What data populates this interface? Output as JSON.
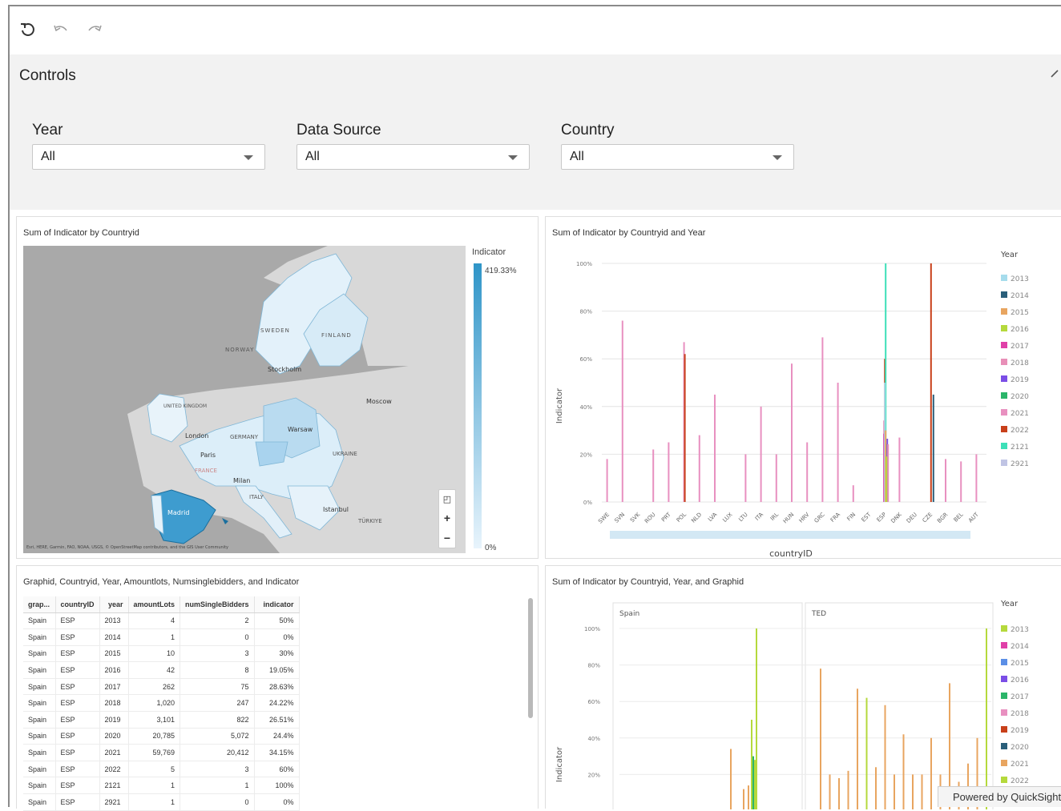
{
  "toolbar": {
    "icons": [
      "reset-icon",
      "undo-icon",
      "redo-icon"
    ]
  },
  "controls": {
    "title": "Controls",
    "year": {
      "label": "Year",
      "value": "All"
    },
    "data_source": {
      "label": "Data Source",
      "value": "All"
    },
    "country": {
      "label": "Country",
      "value": "All"
    }
  },
  "map_panel": {
    "title": "Sum of Indicator by Countryid",
    "legend_title": "Indicator",
    "legend_max": "419.33%",
    "legend_min": "0%",
    "attribution": "Esri, HERE, Garmin, FAO, NOAA, USGS, © OpenStreetMap contributors, and the GIS User Community",
    "labels": [
      "SWEDEN",
      "FINLAND",
      "NORWAY",
      "Stockholm",
      "Moscow",
      "UNITED KINGDOM",
      "London",
      "GERMANY",
      "Warsaw",
      "Paris",
      "FRANCE",
      "UKRAINE",
      "Milan",
      "ITALY",
      "Madrid",
      "Istanbul",
      "TÜRKIYE"
    ]
  },
  "bar_panel": {
    "title": "Sum of Indicator by Countryid and Year",
    "x_label": "countryID",
    "y_label": "Indicator",
    "legend_title": "Year"
  },
  "colors": {
    "2013": "#a6dcec",
    "2014": "#2a5f7a",
    "2015": "#e8a560",
    "2016": "#b5d93c",
    "2017": "#e040a8",
    "2018": "#e88fb8",
    "2019": "#7b4ee6",
    "2020": "#2bb56a",
    "2021": "#e890c0",
    "2022": "#c8401a",
    "2121": "#3de0b8",
    "2921": "#c0c4e4"
  },
  "chart_data": [
    {
      "type": "bar",
      "title": "Sum of Indicator by Countryid and Year",
      "xlabel": "countryID",
      "ylabel": "Indicator",
      "ylim": [
        0,
        100
      ],
      "yticks": [
        "0%",
        "20%",
        "40%",
        "60%",
        "80%",
        "100%"
      ],
      "categories": [
        "SWE",
        "SVN",
        "SVK",
        "ROU",
        "PRT",
        "POL",
        "NLD",
        "LVA",
        "LUX",
        "LTU",
        "ITA",
        "IRL",
        "HUN",
        "HRV",
        "GRC",
        "FRA",
        "FIN",
        "EST",
        "ESP",
        "DNK",
        "DEU",
        "CZE",
        "BGR",
        "BEL",
        "AUT"
      ],
      "legend": [
        "2013",
        "2014",
        "2015",
        "2016",
        "2017",
        "2018",
        "2019",
        "2020",
        "2021",
        "2022",
        "2121",
        "2921"
      ],
      "series": [
        {
          "name": "2021",
          "values": [
            18,
            76,
            0,
            22,
            25,
            67,
            28,
            45,
            0,
            20,
            40,
            20,
            58,
            25,
            69,
            50,
            7,
            0,
            34.15,
            27,
            0,
            0,
            18,
            17,
            20
          ]
        },
        {
          "name": "2022",
          "values": [
            0,
            0,
            0,
            0,
            0,
            62,
            0,
            0,
            0,
            0,
            0,
            0,
            0,
            0,
            0,
            0,
            0,
            0,
            60,
            0,
            0,
            100,
            0,
            0,
            0
          ]
        },
        {
          "name": "2121",
          "values": [
            0,
            0,
            0,
            0,
            0,
            0,
            0,
            0,
            0,
            0,
            0,
            0,
            0,
            0,
            0,
            0,
            0,
            0,
            100,
            0,
            0,
            0,
            0,
            0,
            0
          ]
        },
        {
          "name": "2020",
          "values": [
            0,
            0,
            0,
            0,
            0,
            0,
            0,
            0,
            0,
            0,
            0,
            0,
            0,
            0,
            0,
            0,
            0,
            0,
            24.4,
            0,
            0,
            0,
            0,
            0,
            0
          ]
        },
        {
          "name": "2019",
          "values": [
            0,
            0,
            0,
            0,
            0,
            0,
            0,
            0,
            0,
            0,
            0,
            0,
            0,
            0,
            0,
            0,
            0,
            0,
            26.51,
            0,
            0,
            0,
            0,
            0,
            0
          ]
        },
        {
          "name": "2018",
          "values": [
            0,
            0,
            0,
            0,
            0,
            0,
            0,
            0,
            0,
            0,
            0,
            0,
            0,
            0,
            0,
            0,
            0,
            0,
            24.22,
            0,
            0,
            0,
            0,
            0,
            0
          ]
        },
        {
          "name": "2017",
          "values": [
            0,
            0,
            0,
            0,
            0,
            0,
            0,
            0,
            0,
            0,
            0,
            0,
            0,
            0,
            0,
            0,
            0,
            0,
            28.63,
            0,
            0,
            0,
            0,
            0,
            0
          ]
        },
        {
          "name": "2013",
          "values": [
            0,
            0,
            0,
            0,
            0,
            0,
            0,
            0,
            0,
            0,
            0,
            0,
            0,
            0,
            0,
            0,
            0,
            0,
            50,
            0,
            0,
            0,
            0,
            0,
            0
          ]
        },
        {
          "name": "2015",
          "values": [
            0,
            0,
            0,
            0,
            0,
            0,
            0,
            0,
            0,
            0,
            0,
            0,
            0,
            0,
            0,
            0,
            0,
            0,
            30,
            0,
            0,
            0,
            0,
            0,
            0
          ]
        },
        {
          "name": "2016",
          "values": [
            0,
            0,
            0,
            0,
            0,
            0,
            0,
            0,
            0,
            0,
            0,
            0,
            0,
            0,
            0,
            0,
            0,
            0,
            19.05,
            0,
            0,
            0,
            0,
            0,
            0
          ]
        },
        {
          "name": "2014",
          "values": [
            0,
            0,
            0,
            0,
            0,
            0,
            0,
            0,
            0,
            0,
            0,
            0,
            0,
            0,
            0,
            0,
            0,
            0,
            0,
            0,
            0,
            45,
            0,
            0,
            0
          ]
        }
      ]
    },
    {
      "type": "bar",
      "title": "Sum of Indicator by Countryid, Year, and Graphid",
      "ylabel": "Indicator",
      "ylim": [
        0,
        100
      ],
      "yticks": [
        "20%",
        "40%",
        "60%",
        "80%",
        "100%"
      ],
      "facets": [
        "Spain",
        "TED"
      ],
      "legend": [
        "2013",
        "2014",
        "2015",
        "2016",
        "2017",
        "2018",
        "2019",
        "2020",
        "2021",
        "2022"
      ],
      "legend_colors": [
        "#b5d93c",
        "#e040a8",
        "#5b8fe6",
        "#7b4ee6",
        "#2bb56a",
        "#e890c0",
        "#c8401a",
        "#2a5f7a",
        "#e8a560",
        "#b5d93c"
      ],
      "spain_bars": [
        {
          "v": 34,
          "c": "#e8a560"
        },
        {
          "v": 12,
          "c": "#e8a560"
        },
        {
          "v": 14,
          "c": "#e8a560"
        },
        {
          "v": 50,
          "c": "#b5d93c"
        },
        {
          "v": 30,
          "c": "#2bb56a"
        },
        {
          "v": 28,
          "c": "#b5d93c"
        },
        {
          "v": 100,
          "c": "#b5d93c"
        }
      ],
      "ted_bars": [
        {
          "v": 78,
          "c": "#e8a560"
        },
        {
          "v": 20,
          "c": "#e8a560"
        },
        {
          "v": 18,
          "c": "#e8a560"
        },
        {
          "v": 22,
          "c": "#e8a560"
        },
        {
          "v": 67,
          "c": "#e8a560"
        },
        {
          "v": 62,
          "c": "#b5d93c"
        },
        {
          "v": 24,
          "c": "#e8a560"
        },
        {
          "v": 58,
          "c": "#e8a560"
        },
        {
          "v": 20,
          "c": "#e8a560"
        },
        {
          "v": 42,
          "c": "#e8a560"
        },
        {
          "v": 20,
          "c": "#e8a560"
        },
        {
          "v": 20,
          "c": "#e8a560"
        },
        {
          "v": 40,
          "c": "#e8a560"
        },
        {
          "v": 20,
          "c": "#e8a560"
        },
        {
          "v": 70,
          "c": "#e8a560"
        },
        {
          "v": 16,
          "c": "#e8a560"
        },
        {
          "v": 26,
          "c": "#e8a560"
        },
        {
          "v": 40,
          "c": "#e8a560"
        },
        {
          "v": 100,
          "c": "#b5d93c"
        }
      ]
    }
  ],
  "table_panel": {
    "title": "Graphid, Countryid, Year, Amountlots, Numsinglebidders, and Indicator",
    "columns": [
      "grap...",
      "countryID",
      "year",
      "amountLots",
      "numSingleBidders",
      "indicator"
    ],
    "rows": [
      [
        "Spain",
        "ESP",
        "2013",
        "4",
        "2",
        "50%"
      ],
      [
        "Spain",
        "ESP",
        "2014",
        "1",
        "0",
        "0%"
      ],
      [
        "Spain",
        "ESP",
        "2015",
        "10",
        "3",
        "30%"
      ],
      [
        "Spain",
        "ESP",
        "2016",
        "42",
        "8",
        "19.05%"
      ],
      [
        "Spain",
        "ESP",
        "2017",
        "262",
        "75",
        "28.63%"
      ],
      [
        "Spain",
        "ESP",
        "2018",
        "1,020",
        "247",
        "24.22%"
      ],
      [
        "Spain",
        "ESP",
        "2019",
        "3,101",
        "822",
        "26.51%"
      ],
      [
        "Spain",
        "ESP",
        "2020",
        "20,785",
        "5,072",
        "24.4%"
      ],
      [
        "Spain",
        "ESP",
        "2021",
        "59,769",
        "20,412",
        "34.15%"
      ],
      [
        "Spain",
        "ESP",
        "2022",
        "5",
        "3",
        "60%"
      ],
      [
        "Spain",
        "ESP",
        "2121",
        "1",
        "1",
        "100%"
      ],
      [
        "Spain",
        "ESP",
        "2921",
        "1",
        "0",
        "0%"
      ]
    ]
  },
  "facet_panel": {
    "title": "Sum of Indicator by Countryid, Year, and Graphid",
    "y_label": "Indicator",
    "legend_title": "Year",
    "facet_left": "Spain",
    "facet_right": "TED"
  },
  "badge": {
    "text": "Powered by QuickSight"
  }
}
